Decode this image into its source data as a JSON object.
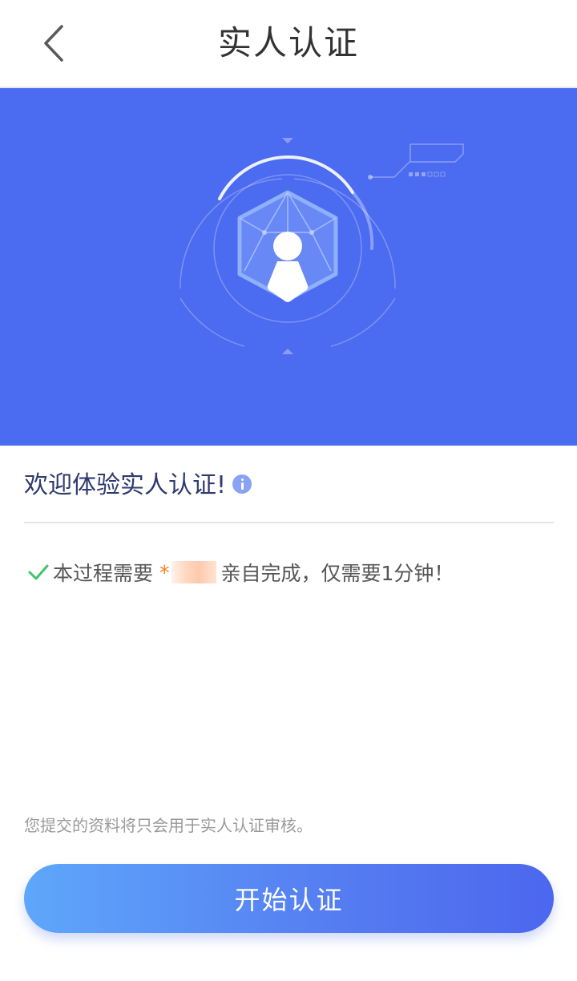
{
  "navbar": {
    "title": "实人认证",
    "back_icon": "chevron-left-icon"
  },
  "hero": {
    "icon": "face-verification-hexagon-icon",
    "background": "#4b6bf0"
  },
  "welcome": {
    "text": "欢迎体验实人认证!",
    "info_icon": "info-icon"
  },
  "requirement": {
    "check_icon": "checkmark-icon",
    "prefix": "本过程需要",
    "star": "*",
    "name": "某某",
    "suffix": "亲自完成，仅需要1分钟！"
  },
  "notice": "您提交的资料将只会用于实人认证审核。",
  "start_button": {
    "label": "开始认证"
  },
  "colors": {
    "accent": "#4b6bf0",
    "check": "#3ec46d",
    "star": "#ff7a1a"
  }
}
